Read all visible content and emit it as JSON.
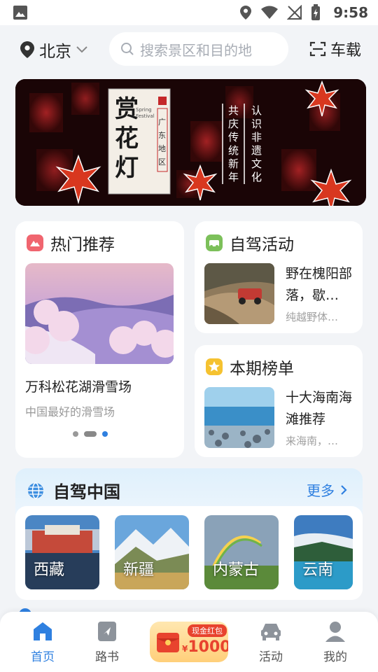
{
  "status_bar": {
    "time": "9:58"
  },
  "header": {
    "city": "北京",
    "search_placeholder": "搜索景区和目的地",
    "car_mode_label": "车载"
  },
  "banner": {
    "title": "赏花灯",
    "tag": "Spring Festival",
    "region": "广东地区",
    "slogan_left": "共庆传统新年",
    "slogan_right": "认识非遗文化"
  },
  "hot": {
    "title": "热门推荐",
    "item_name": "万科松花湖滑雪场",
    "item_desc": "中国最好的滑雪场"
  },
  "drive_event": {
    "title": "自驾活动",
    "item_name": "野在槐阳部落，歇…",
    "item_desc": "纯越野体…"
  },
  "ranking": {
    "title": "本期榜单",
    "item_name": "十大海南海滩推荐",
    "item_desc": "来海南，…"
  },
  "self_drive_china": {
    "title": "自驾中国",
    "more_label": "更多",
    "provinces": [
      "西藏",
      "新疆",
      "内蒙古",
      "云南"
    ]
  },
  "tabbar": {
    "home": "首页",
    "routes": "路书",
    "red_packet_tag": "现金红包",
    "red_packet_amount": "1000",
    "red_packet_currency": "¥",
    "activity": "活动",
    "mine": "我的"
  },
  "colors": {
    "accent": "#2f80e0",
    "red": "#e8432e",
    "background": "#f2f4f7"
  }
}
